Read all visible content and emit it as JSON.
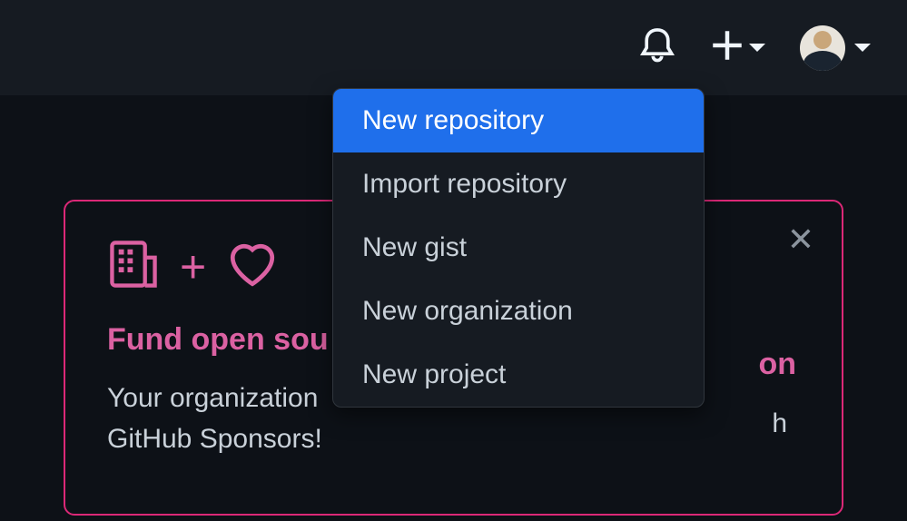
{
  "dropdown": {
    "items": [
      {
        "label": "New repository",
        "selected": true
      },
      {
        "label": "Import repository",
        "selected": false
      },
      {
        "label": "New gist",
        "selected": false
      },
      {
        "label": "New organization",
        "selected": false
      },
      {
        "label": "New project",
        "selected": false
      }
    ]
  },
  "promo": {
    "title_visible_left": "Fund open sou",
    "title_visible_right": "on",
    "body_line1_left": "Your organization",
    "body_line1_right": "h",
    "body_line2": "GitHub Sponsors!",
    "plus_glyph": "+"
  },
  "colors": {
    "bg": "#0d1117",
    "header_bg": "#161b22",
    "accent_pink": "#db61a2",
    "border_pink": "#db2877",
    "highlight_blue": "#1f6feb",
    "text": "#c9d1d9"
  }
}
